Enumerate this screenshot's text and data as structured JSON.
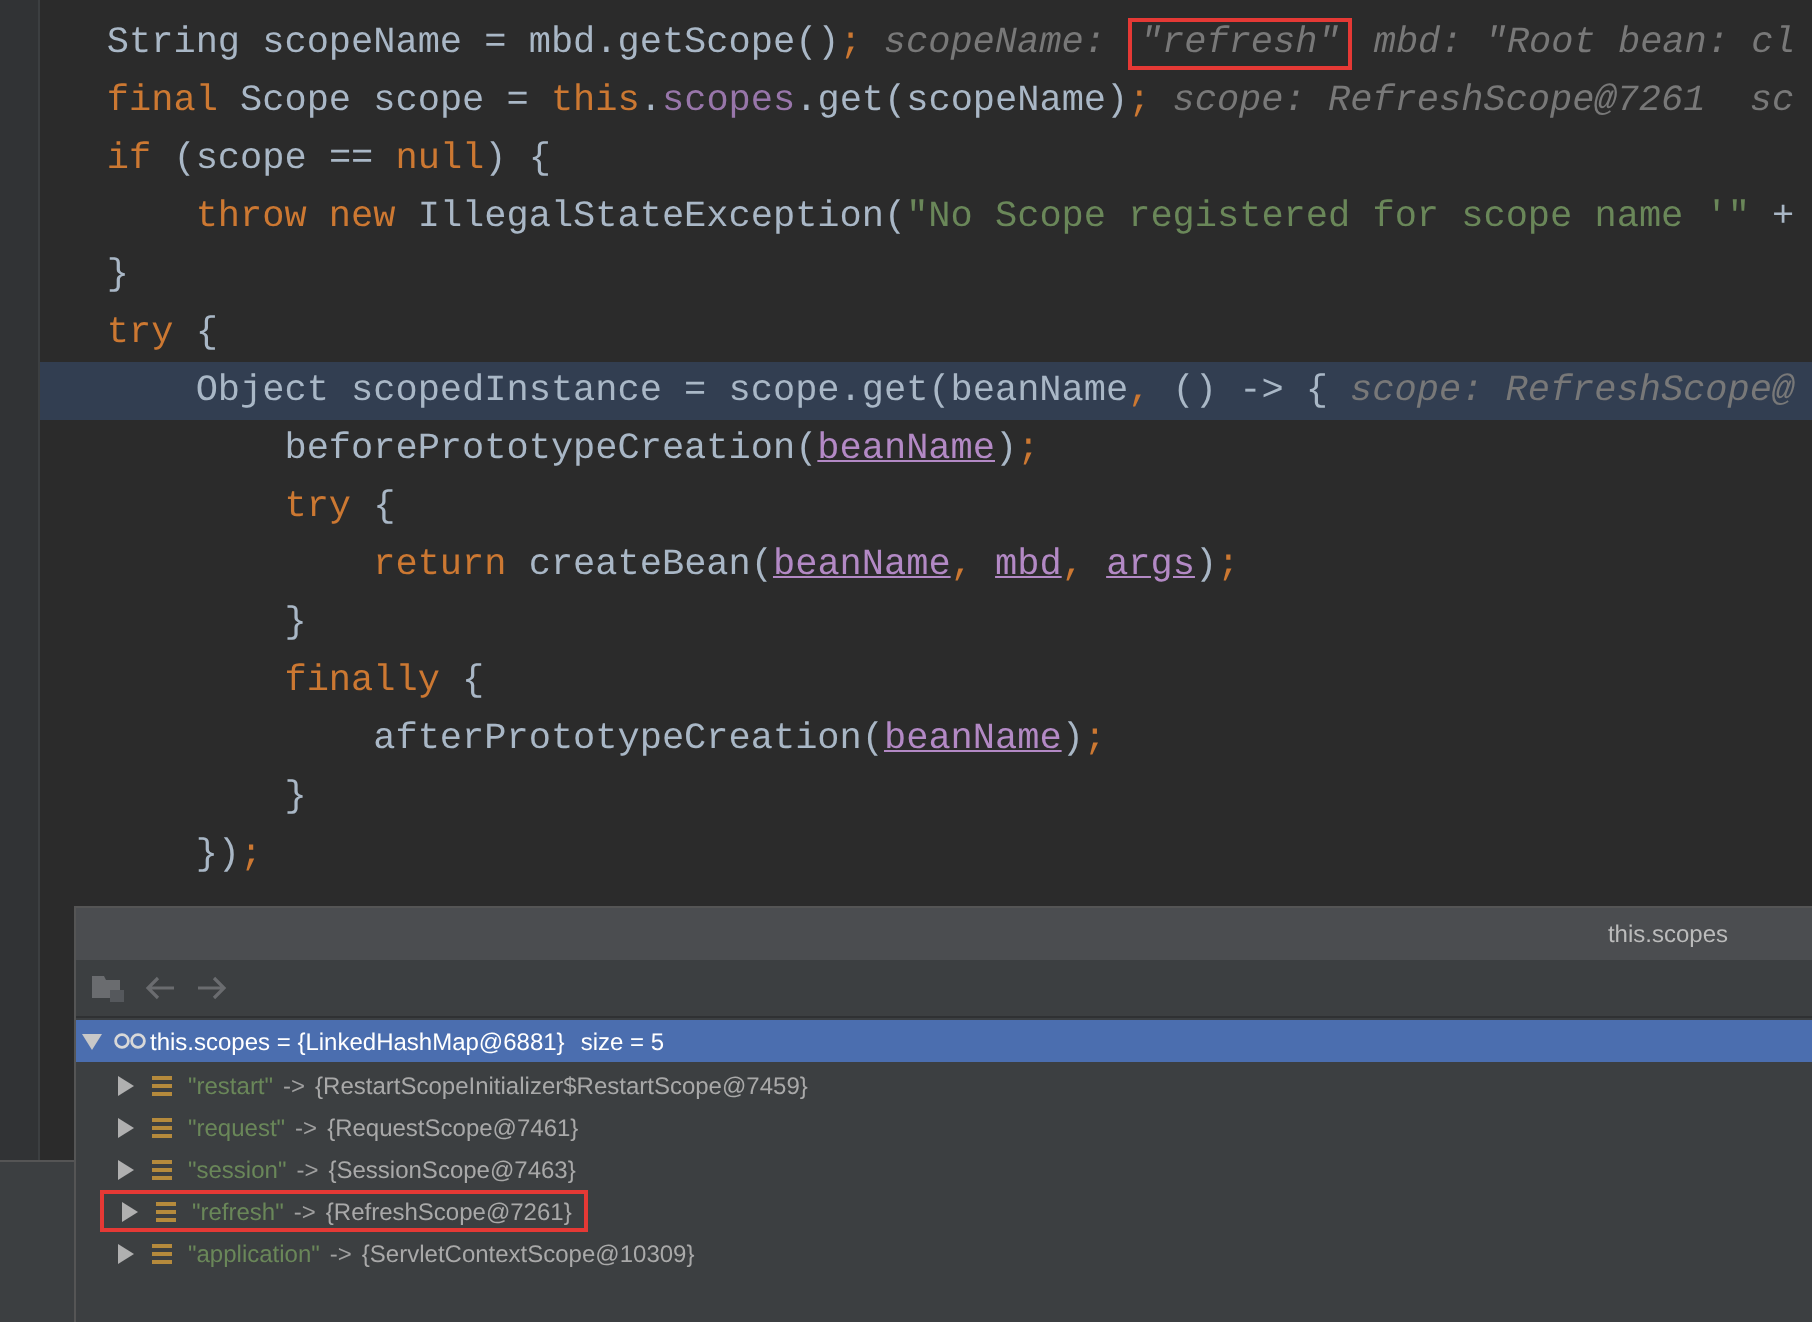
{
  "editor": {
    "lines": [
      {
        "selected": false,
        "code": [
          {
            "kind": "plain",
            "t": "    String scopeName = mbd.getScope()"
          },
          {
            "kind": "kw",
            "t": ";"
          }
        ],
        "hints": [
          {
            "t": "scopeName:",
            "boxed": false
          },
          {
            "t": "\"refresh\"",
            "boxed": true
          },
          {
            "t": "mbd: \"Root bean: cl",
            "boxed": false
          }
        ]
      },
      {
        "selected": false,
        "code": [
          {
            "kind": "kw",
            "t": "    final"
          },
          {
            "kind": "plain",
            "t": " Scope scope = "
          },
          {
            "kind": "kw",
            "t": "this"
          },
          {
            "kind": "plain",
            "t": "."
          },
          {
            "kind": "field",
            "t": "scopes"
          },
          {
            "kind": "plain",
            "t": ".get(scopeName)"
          },
          {
            "kind": "kw",
            "t": ";"
          }
        ],
        "hints": [
          {
            "t": "scope: RefreshScope@7261  sc",
            "boxed": false
          }
        ]
      },
      {
        "selected": false,
        "code": [
          {
            "kind": "kw",
            "t": "    if"
          },
          {
            "kind": "plain",
            "t": " (scope == "
          },
          {
            "kind": "kw",
            "t": "null"
          },
          {
            "kind": "plain",
            "t": ") {"
          }
        ]
      },
      {
        "selected": false,
        "code": [
          {
            "kind": "kw",
            "t": "        throw new"
          },
          {
            "kind": "plain",
            "t": " IllegalStateException("
          },
          {
            "kind": "string",
            "t": "\"No Scope registered for scope name '\""
          },
          {
            "kind": "plain",
            "t": " +"
          }
        ]
      },
      {
        "selected": false,
        "code": [
          {
            "kind": "plain",
            "t": "    }"
          }
        ]
      },
      {
        "selected": false,
        "code": [
          {
            "kind": "kw",
            "t": "    try"
          },
          {
            "kind": "plain",
            "t": " {"
          }
        ]
      },
      {
        "selected": true,
        "code": [
          {
            "kind": "plain",
            "t": "        Object scopedInstance = scope.get(beanName"
          },
          {
            "kind": "kw",
            "t": ","
          },
          {
            "kind": "plain",
            "t": " () -> {"
          }
        ],
        "hints": [
          {
            "t": "scope: RefreshScope@",
            "boxed": false
          }
        ]
      },
      {
        "selected": false,
        "code": [
          {
            "kind": "plain",
            "t": "            beforePrototypeCreation("
          },
          {
            "kind": "param",
            "t": "beanName"
          },
          {
            "kind": "plain",
            "t": ")"
          },
          {
            "kind": "kw",
            "t": ";"
          }
        ]
      },
      {
        "selected": false,
        "code": [
          {
            "kind": "kw",
            "t": "            try"
          },
          {
            "kind": "plain",
            "t": " {"
          }
        ]
      },
      {
        "selected": false,
        "code": [
          {
            "kind": "kw",
            "t": "                return"
          },
          {
            "kind": "plain",
            "t": " createBean("
          },
          {
            "kind": "param",
            "t": "beanName"
          },
          {
            "kind": "kw",
            "t": ", "
          },
          {
            "kind": "param",
            "t": "mbd"
          },
          {
            "kind": "kw",
            "t": ", "
          },
          {
            "kind": "param",
            "t": "args"
          },
          {
            "kind": "plain",
            "t": ")"
          },
          {
            "kind": "kw",
            "t": ";"
          }
        ]
      },
      {
        "selected": false,
        "code": [
          {
            "kind": "plain",
            "t": "            }"
          }
        ]
      },
      {
        "selected": false,
        "code": [
          {
            "kind": "kw",
            "t": "            finally"
          },
          {
            "kind": "plain",
            "t": " {"
          }
        ]
      },
      {
        "selected": false,
        "code": [
          {
            "kind": "plain",
            "t": "                afterPrototypeCreation("
          },
          {
            "kind": "param",
            "t": "beanName"
          },
          {
            "kind": "plain",
            "t": ")"
          },
          {
            "kind": "kw",
            "t": ";"
          }
        ]
      },
      {
        "selected": false,
        "code": [
          {
            "kind": "plain",
            "t": "            }"
          }
        ]
      },
      {
        "selected": false,
        "code": [
          {
            "kind": "plain",
            "t": "        })"
          },
          {
            "kind": "kw",
            "t": ";"
          }
        ]
      }
    ]
  },
  "popup": {
    "title": "this.scopes",
    "toolbar": [
      {
        "kind": "folder",
        "disabled": true
      },
      {
        "kind": "back",
        "disabled": true
      },
      {
        "kind": "forward",
        "disabled": true
      }
    ],
    "tree": {
      "text": "this.scopes = {LinkedHashMap@6881}",
      "size": "size = 5",
      "selected": true,
      "expanded": true,
      "children": [
        {
          "key": "\"restart\"",
          "arrow": "->",
          "value": "{RestartScopeInitializer$RestartScope@7459}",
          "expanded": false,
          "selected": false,
          "boxed": false
        },
        {
          "key": "\"request\"",
          "arrow": "->",
          "value": "{RequestScope@7461}",
          "expanded": false,
          "selected": false,
          "boxed": false
        },
        {
          "key": "\"session\"",
          "arrow": "->",
          "value": "{SessionScope@7463}",
          "expanded": false,
          "selected": false,
          "boxed": false
        },
        {
          "key": "\"refresh\"",
          "arrow": "->",
          "value": "{RefreshScope@7261}",
          "expanded": false,
          "selected": false,
          "boxed": true
        },
        {
          "key": "\"application\"",
          "arrow": "->",
          "value": "{ServletContextScope@10309}",
          "expanded": false,
          "selected": false,
          "boxed": false
        }
      ]
    }
  }
}
